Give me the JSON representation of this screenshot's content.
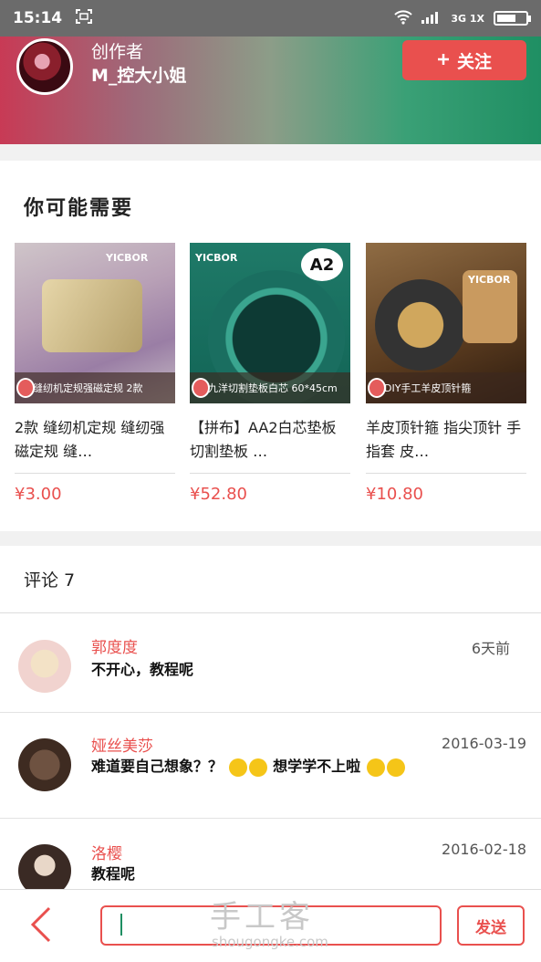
{
  "status_bar": {
    "time": "15:14",
    "network_label": "3G 1X"
  },
  "author": {
    "subtitle": "创作者",
    "name": "M_控大小姐",
    "follow_label": "关注"
  },
  "recommend": {
    "title": "你可能需要",
    "items": [
      {
        "caption": "缝纫机定规强磁定规 2款",
        "brand": "YICBOR",
        "title": "2款 缝纫机定规 缝纫强磁定规 缝…",
        "price": "¥3.00"
      },
      {
        "caption": "九洋切割垫板白芯 60*45cm",
        "brand": "YICBOR",
        "badge": "A2",
        "title": "【拼布】AA2白芯垫板 切割垫板 …",
        "price": "¥52.80"
      },
      {
        "caption": "DIY手工羊皮顶针箍",
        "brand": "YICBOR",
        "title": "羊皮顶针箍 指尖顶针 手指套 皮…",
        "price": "¥10.80"
      }
    ]
  },
  "comments": {
    "header": "评论 7",
    "items": [
      {
        "name": "郭度度",
        "time": "6天前",
        "text": "不开心，教程呢"
      },
      {
        "name": "娅丝美莎",
        "time": "2016-03-19",
        "text_a": "难道要自己想象？？",
        "text_b": "想学学不上啦"
      },
      {
        "name": "洛樱",
        "time": "2016-02-18",
        "text": "教程呢"
      }
    ]
  },
  "bottom": {
    "input_value": "",
    "send_label": "发送",
    "watermark": "手工客",
    "watermark_sub": "shougongke.com"
  },
  "colors": {
    "accent": "#e9504e",
    "banner_start": "#c83a55",
    "banner_end": "#1f8f63"
  }
}
